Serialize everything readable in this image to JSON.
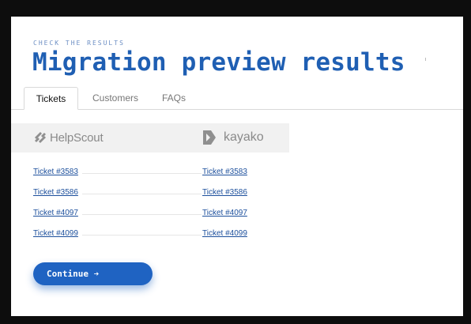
{
  "header": {
    "eyebrow": "CHECK THE RESULTS",
    "title": "Migration preview results"
  },
  "tabs": [
    {
      "label": "Tickets",
      "active": true
    },
    {
      "label": "Customers",
      "active": false
    },
    {
      "label": "FAQs",
      "active": false
    }
  ],
  "logos": {
    "source": "HelpScout",
    "target": "kayako"
  },
  "rows": [
    {
      "source": "Ticket #3583",
      "target": "Ticket #3583"
    },
    {
      "source": "Ticket #3586",
      "target": "Ticket #3586"
    },
    {
      "source": "Ticket #4097",
      "target": "Ticket #4097"
    },
    {
      "source": "Ticket #4099",
      "target": "Ticket #4099"
    }
  ],
  "continue_button": {
    "label": "Continue ➔"
  },
  "colors": {
    "accent": "#1f63c2",
    "title": "#1f5fb3",
    "link": "#1c4f9c",
    "logo_band": "#f1f1f1"
  }
}
